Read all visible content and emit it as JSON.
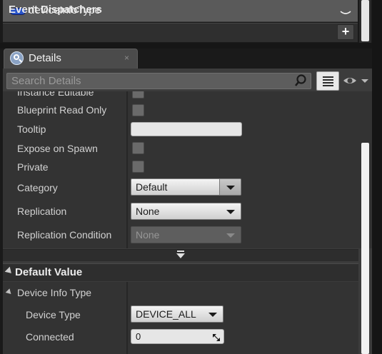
{
  "variable": {
    "name": "deviceInfoType",
    "pin_color": "#2753c8"
  },
  "event_dispatchers": {
    "label": "Event Dispatchers",
    "add_symbol": "+"
  },
  "details_tab": {
    "label": "Details",
    "close_symbol": "×"
  },
  "search": {
    "placeholder": "Search Details",
    "value": ""
  },
  "properties": [
    {
      "label": "Instance Editable",
      "kind": "checkbox",
      "checked": false
    },
    {
      "label": "Blueprint Read Only",
      "kind": "checkbox",
      "checked": false
    },
    {
      "label": "Tooltip",
      "kind": "text",
      "value": ""
    },
    {
      "label": "Expose on Spawn",
      "kind": "checkbox",
      "checked": false
    },
    {
      "label": "Private",
      "kind": "checkbox",
      "checked": false
    },
    {
      "label": "Category",
      "kind": "dropdown",
      "value": "Default"
    },
    {
      "label": "Replication",
      "kind": "dropdown",
      "value": "None"
    },
    {
      "label": "Replication Condition",
      "kind": "dropdown",
      "value": "None",
      "disabled": true
    }
  ],
  "default_value": {
    "header": "Default Value",
    "struct_label": "Device Info Type",
    "fields": [
      {
        "label": "Device Type",
        "kind": "dropdown",
        "value": "DEVICE_ALL"
      },
      {
        "label": "Connected",
        "kind": "number",
        "value": "0"
      }
    ]
  },
  "colors": {
    "panel": "#3c3c3c",
    "grid": "#333333",
    "accent": "#2753c8"
  }
}
